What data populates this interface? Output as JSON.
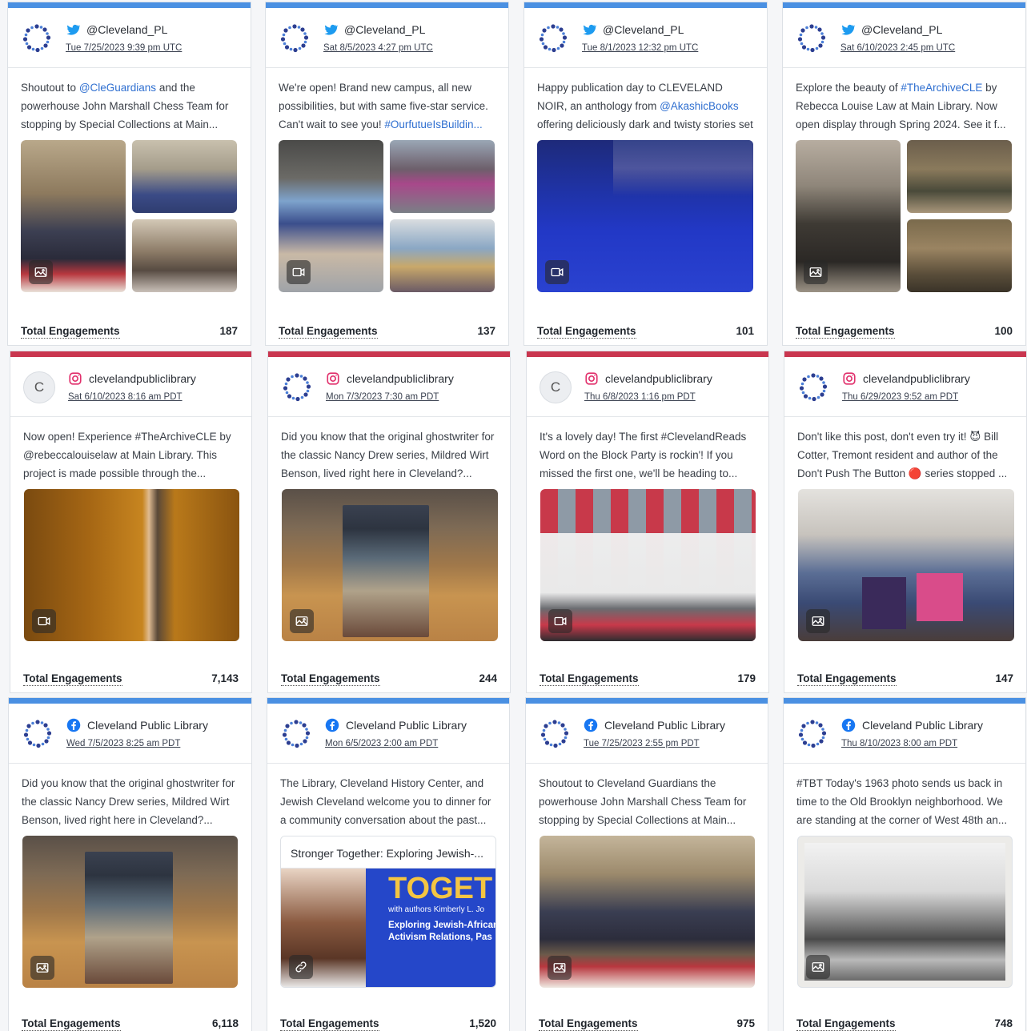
{
  "colors": {
    "twitter": "#4a90e2",
    "instagram": "#c9364f",
    "facebook": "#4a90e2",
    "link": "#2f6fd0"
  },
  "engagement_label": "Total Engagements",
  "posts": [
    {
      "platform": "twitter",
      "avatar": "logo",
      "handle": "@Cleveland_PL",
      "date": "Tue 7/25/2023 9:39 pm UTC",
      "text_before": "Shoutout to ",
      "mention": "@CleGuardians",
      "text_after": " and the powerhouse John Marshall Chess Team for stopping by Special Collections at Main...",
      "media": "image",
      "engagements": "187"
    },
    {
      "platform": "twitter",
      "avatar": "logo",
      "handle": "@Cleveland_PL",
      "date": "Sat 8/5/2023 4:27 pm UTC",
      "text_before": "We're open! Brand new campus, all new possibilities, but with same five-star service. Can't wait to see you! ",
      "mention": "#OurfutueIsBuildin...",
      "text_after": "",
      "media": "video",
      "engagements": "137"
    },
    {
      "platform": "twitter",
      "avatar": "logo",
      "handle": "@Cleveland_PL",
      "date": "Tue 8/1/2023 12:32 pm UTC",
      "text_before": "Happy publication day to CLEVELAND NOIR, an anthology from ",
      "mention": "@AkashicBooks",
      "text_after": " offering deliciously dark and twisty stories set in...",
      "media": "video",
      "engagements": "101"
    },
    {
      "platform": "twitter",
      "avatar": "logo",
      "handle": "@Cleveland_PL",
      "date": "Sat 6/10/2023 2:45 pm UTC",
      "text_before": "Explore the beauty of ",
      "mention": "#TheArchiveCLE",
      "text_after": " by Rebecca Louise Law at Main Library. Now open display through Spring 2024. See it f...",
      "media": "image",
      "engagements": "100"
    },
    {
      "platform": "instagram",
      "avatar": "letter",
      "avatar_letter": "C",
      "handle": "clevelandpubliclibrary",
      "date": "Sat 6/10/2023 8:16 am PDT",
      "text_before": "Now open! Experience #TheArchiveCLE by @rebeccalouiselaw at Main Library. This project is made possible through the...",
      "mention": "",
      "text_after": "",
      "media": "video",
      "engagements": "7,143"
    },
    {
      "platform": "instagram",
      "avatar": "logo",
      "handle": "clevelandpubliclibrary",
      "date": "Mon 7/3/2023 7:30 am PDT",
      "text_before": "Did you know that the original ghostwriter for the classic Nancy Drew series, Mildred Wirt Benson, lived right here in Cleveland?...",
      "mention": "",
      "text_after": "",
      "media": "image",
      "engagements": "244"
    },
    {
      "platform": "instagram",
      "avatar": "letter",
      "avatar_letter": "C",
      "handle": "clevelandpubliclibrary",
      "date": "Thu 6/8/2023 1:16 pm PDT",
      "text_before": "It's a lovely day! The first #ClevelandReads Word on the Block Party is rockin'! If you missed the first one, we'll be heading to...",
      "mention": "",
      "text_after": "",
      "media": "video",
      "engagements": "179"
    },
    {
      "platform": "instagram",
      "avatar": "logo",
      "handle": "clevelandpubliclibrary",
      "date": "Thu 6/29/2023 9:52 am PDT",
      "text_before": "Don't like this post, don't even try it! 😈 Bill Cotter, Tremont resident and author of the Don't Push The Button 🔴 series stopped ...",
      "mention": "",
      "text_after": "",
      "media": "image",
      "engagements": "147"
    },
    {
      "platform": "facebook",
      "avatar": "logo",
      "handle": "Cleveland Public Library",
      "date": "Wed 7/5/2023 8:25 am PDT",
      "text_before": "Did you know that the original ghostwriter for the classic Nancy Drew series, Mildred Wirt Benson, lived right here in Cleveland?...",
      "mention": "",
      "text_after": "",
      "media": "image",
      "engagements": "6,118"
    },
    {
      "platform": "facebook",
      "avatar": "logo",
      "handle": "Cleveland Public Library",
      "date": "Mon 6/5/2023 2:00 am PDT",
      "text_before": "The Library, Cleveland History Center, and Jewish Cleveland welcome you to dinner for a community conversation about the past...",
      "mention": "",
      "text_after": "",
      "media": "link",
      "link_title": "Stronger Together: Exploring Jewish-...",
      "link_image_text": {
        "headline": "TOGET",
        "sub": "with authors Kimberly L. Jo",
        "body": "Exploring Jewish-African Activism Relations, Pas"
      },
      "engagements": "1,520"
    },
    {
      "platform": "facebook",
      "avatar": "logo",
      "handle": "Cleveland Public Library",
      "date": "Tue 7/25/2023 2:55 pm PDT",
      "text_before": "Shoutout to Cleveland Guardians the powerhouse John Marshall Chess Team for stopping by Special Collections at Main...",
      "mention": "",
      "text_after": "",
      "media": "image",
      "engagements": "975"
    },
    {
      "platform": "facebook",
      "avatar": "logo",
      "handle": "Cleveland Public Library",
      "date": "Thu 8/10/2023 8:00 am PDT",
      "text_before": "#TBT Today's 1963 photo sends us back in time to the Old Brooklyn neighborhood. We are standing at the corner of West 48th an...",
      "mention": "",
      "text_after": "",
      "media": "image",
      "engagements": "748"
    }
  ]
}
